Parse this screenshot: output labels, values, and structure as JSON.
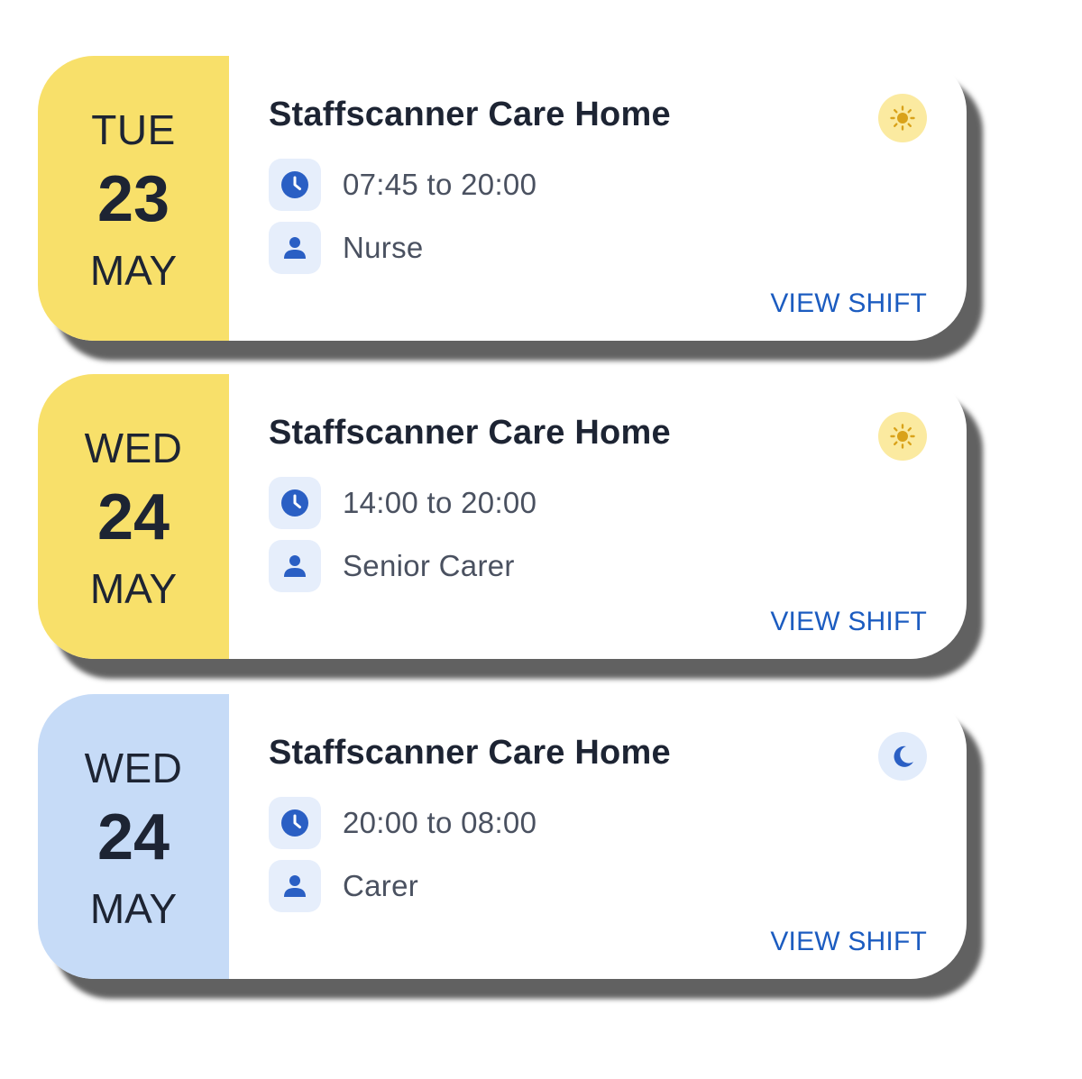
{
  "shifts": [
    {
      "weekday": "TUE",
      "day": "23",
      "month": "MAY",
      "site": "Staffscanner Care Home",
      "time": "07:45 to 20:00",
      "role": "Nurse",
      "shift_type": "day",
      "shift_type_icon": "sun-icon",
      "action": "VIEW SHIFT"
    },
    {
      "weekday": "WED",
      "day": "24",
      "month": "MAY",
      "site": "Staffscanner Care Home",
      "time": "14:00 to 20:00",
      "role": "Senior Carer",
      "shift_type": "day",
      "shift_type_icon": "sun-icon",
      "action": "VIEW SHIFT"
    },
    {
      "weekday": "WED",
      "day": "24",
      "month": "MAY",
      "site": "Staffscanner Care Home",
      "time": "20:00 to 08:00",
      "role": "Carer",
      "shift_type": "night",
      "shift_type_icon": "moon-icon",
      "action": "VIEW SHIFT"
    }
  ],
  "icons": {
    "time": "clock-icon",
    "role": "person-icon"
  },
  "colors": {
    "day_accent": "#f8e06a",
    "night_accent": "#c6dbf7",
    "link": "#1c5cc0",
    "icon_blue": "#2a5fc4",
    "sun": "#d9a21a"
  }
}
